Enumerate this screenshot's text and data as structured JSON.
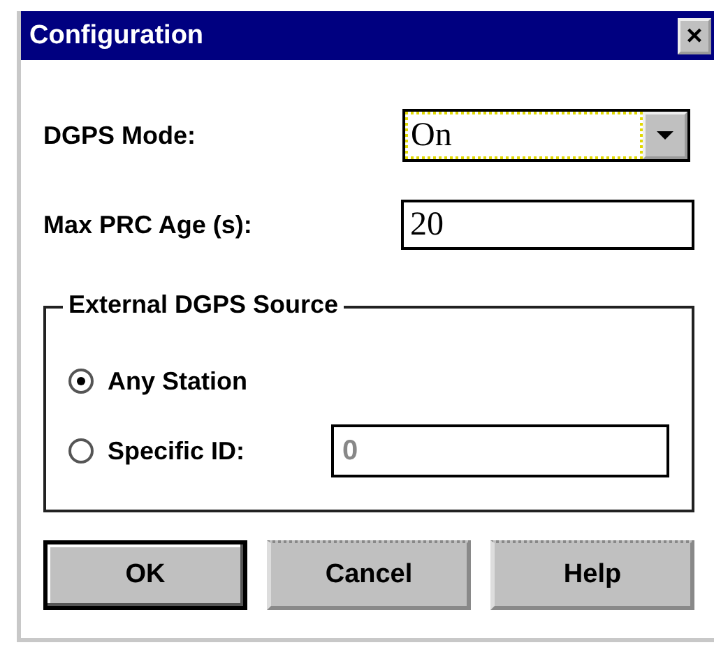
{
  "window": {
    "title": "Configuration",
    "close": "×"
  },
  "fields": [
    {
      "kind": "dropdown",
      "label": "DGPS Mode:",
      "value": "On",
      "focused": true
    },
    {
      "kind": "text",
      "label": "Max PRC Age (s):",
      "value": "20",
      "focused": false
    }
  ],
  "group": {
    "title": "External DGPS Source",
    "options": [
      {
        "label": "Any Station",
        "selected": true
      },
      {
        "label": "Specific ID:",
        "selected": false,
        "field": {
          "value": "0",
          "disabled": true
        }
      }
    ]
  },
  "buttons": [
    {
      "label": "OK",
      "default": true
    },
    {
      "label": "Cancel",
      "default": false
    },
    {
      "label": "Help",
      "default": false
    }
  ]
}
